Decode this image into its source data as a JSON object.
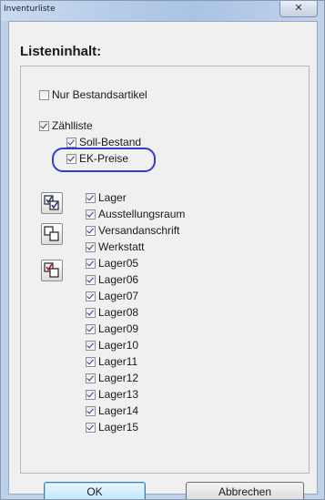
{
  "window": {
    "title": "Inventurliste",
    "close_symbol": "✕"
  },
  "heading": "Listeninhalt:",
  "options": {
    "nur_bestand": {
      "label": "Nur Bestandsartikel",
      "checked": false
    },
    "zaehlliste": {
      "label": "Zählliste",
      "checked": true
    },
    "soll_bestand": {
      "label": "Soll-Bestand",
      "checked": true
    },
    "ek_preise": {
      "label": "EK-Preise",
      "checked": true
    }
  },
  "warehouses": [
    {
      "label": "Lager",
      "checked": true
    },
    {
      "label": "Ausstellungsraum",
      "checked": true
    },
    {
      "label": "Versandanschrift",
      "checked": true
    },
    {
      "label": "Werkstatt",
      "checked": true
    },
    {
      "label": "Lager05",
      "checked": true
    },
    {
      "label": "Lager06",
      "checked": true
    },
    {
      "label": "Lager07",
      "checked": true
    },
    {
      "label": "Lager08",
      "checked": true
    },
    {
      "label": "Lager09",
      "checked": true
    },
    {
      "label": "Lager10",
      "checked": true
    },
    {
      "label": "Lager11",
      "checked": true
    },
    {
      "label": "Lager12",
      "checked": true
    },
    {
      "label": "Lager13",
      "checked": true
    },
    {
      "label": "Lager14",
      "checked": true
    },
    {
      "label": "Lager15",
      "checked": true
    }
  ],
  "icons": [
    "select-all-icon",
    "select-none-icon",
    "invert-selection-icon"
  ],
  "buttons": {
    "ok": "OK",
    "cancel": "Abbrechen"
  },
  "colors": {
    "highlight": "#2e3ec9",
    "check": "#2a3a8c"
  }
}
